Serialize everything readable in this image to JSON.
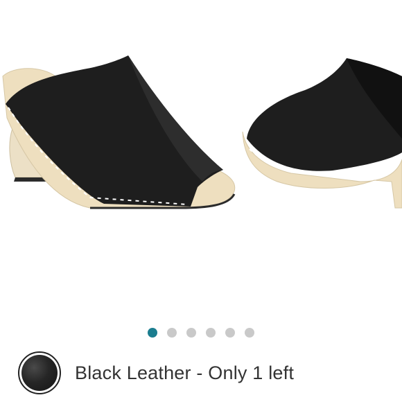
{
  "product": {
    "color_label": "Black Leather - Only 1 left",
    "swatch_color": "#1c1c1c",
    "image_alt_primary": "black leather mule side view",
    "image_alt_secondary": "black leather mule front view"
  },
  "carousel": {
    "total_images": 6,
    "active_index": 0,
    "active_color": "#1b7d8f",
    "inactive_color": "#c9c9c9"
  }
}
